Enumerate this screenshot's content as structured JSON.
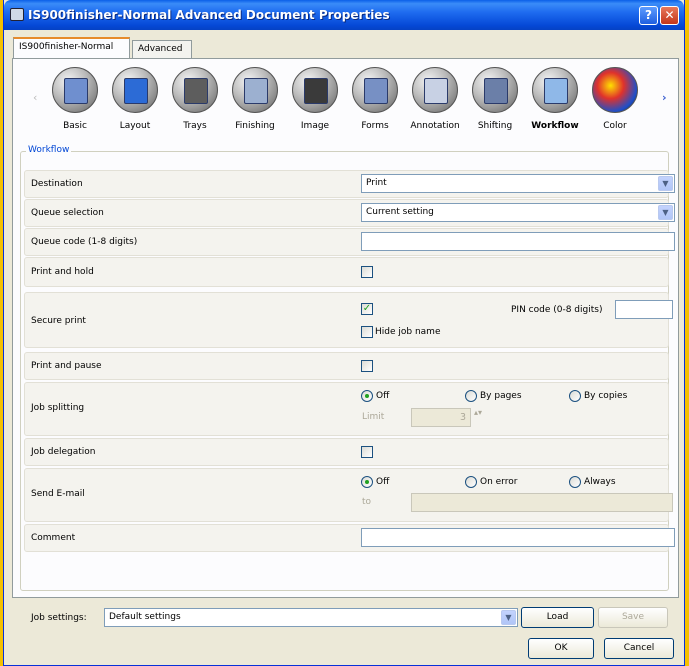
{
  "window": {
    "title": "IS900finisher-Normal Advanced Document Properties",
    "help_button": "?",
    "close_button": "✕"
  },
  "tabs": [
    {
      "label": "IS900finisher-Normal",
      "active": true
    },
    {
      "label": "Advanced",
      "active": false
    }
  ],
  "iconbar": {
    "left_arrow": "‹",
    "right_arrow": "›",
    "features": [
      {
        "label": "Basic",
        "icon": "document-icon",
        "color": "#6f8fcf"
      },
      {
        "label": "Layout",
        "icon": "layout-icon",
        "color": "#2c6bd6"
      },
      {
        "label": "Trays",
        "icon": "paper-trays-icon",
        "color": "#5d5d5d"
      },
      {
        "label": "Finishing",
        "icon": "finishing-icon",
        "color": "#9cb0d0"
      },
      {
        "label": "Image",
        "icon": "image-icon",
        "color": "#3a3a3a"
      },
      {
        "label": "Forms",
        "icon": "forms-icon",
        "color": "#7790c4"
      },
      {
        "label": "Annotation",
        "icon": "annotation-icon",
        "color": "#c8d1e4"
      },
      {
        "label": "Shifting",
        "icon": "shifting-icon",
        "color": "#6b7fa8"
      },
      {
        "label": "Workflow",
        "icon": "workflow-envelope-icon",
        "color": "#8fb8e8",
        "active": true
      },
      {
        "label": "Color",
        "icon": "color-wheel-icon",
        "color": "#e0322b"
      }
    ]
  },
  "workflow": {
    "group_title": "Workflow",
    "destination": {
      "label": "Destination",
      "value": "Print"
    },
    "queue_selection": {
      "label": "Queue selection",
      "value": "Current setting"
    },
    "queue_code": {
      "label": "Queue code (1-8 digits)",
      "value": ""
    },
    "print_and_hold": {
      "label": "Print and hold",
      "checked": false
    },
    "secure_print": {
      "label": "Secure print",
      "checked": true,
      "checkmark": "✓",
      "pin_label": "PIN code (0-8 digits)",
      "pin_value": "",
      "hide_job_name_label": "Hide job name",
      "hide_job_name_checked": false
    },
    "print_and_pause": {
      "label": "Print and pause",
      "checked": false
    },
    "job_splitting": {
      "label": "Job splitting",
      "options": [
        "Off",
        "By pages",
        "By copies"
      ],
      "selected": "Off",
      "limit_label": "Limit",
      "limit_value": "3",
      "spin_arrows": "▴▾"
    },
    "job_delegation": {
      "label": "Job delegation",
      "checked": false
    },
    "send_email": {
      "label": "Send E-mail",
      "options": [
        "Off",
        "On error",
        "Always"
      ],
      "selected": "Off",
      "to_label": "to",
      "to_value": ""
    },
    "comment": {
      "label": "Comment",
      "value": ""
    }
  },
  "footer": {
    "job_settings_label": "Job settings:",
    "job_settings_value": "Default settings",
    "load_label": "Load",
    "save_label": "Save",
    "ok_label": "OK",
    "cancel_label": "Cancel",
    "drop_arrow": "▼"
  }
}
